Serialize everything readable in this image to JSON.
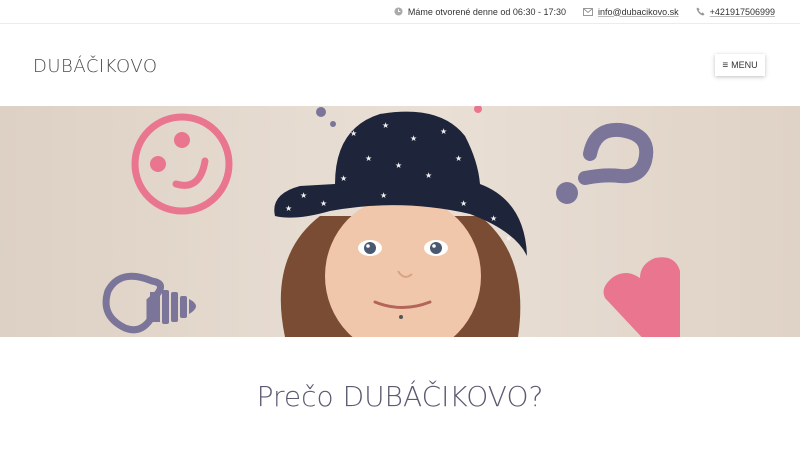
{
  "topbar": {
    "hours": "Máme otvorené denne od 06:30 - 17:30",
    "email": "info@dubacikovo.sk",
    "phone": "+421917506999"
  },
  "header": {
    "logo": "DUBÁČIKOVO",
    "menu_label": "MENU"
  },
  "hero": {
    "icons": [
      "smiley-icon",
      "question-mark-icon",
      "lightbulb-icon",
      "heart-icon"
    ],
    "colors": {
      "pink": "#e9768e",
      "purple": "#7b759a",
      "background": "#e4d9ce"
    }
  },
  "section": {
    "heading": "Prečo DUBÁČIKOVO?"
  }
}
